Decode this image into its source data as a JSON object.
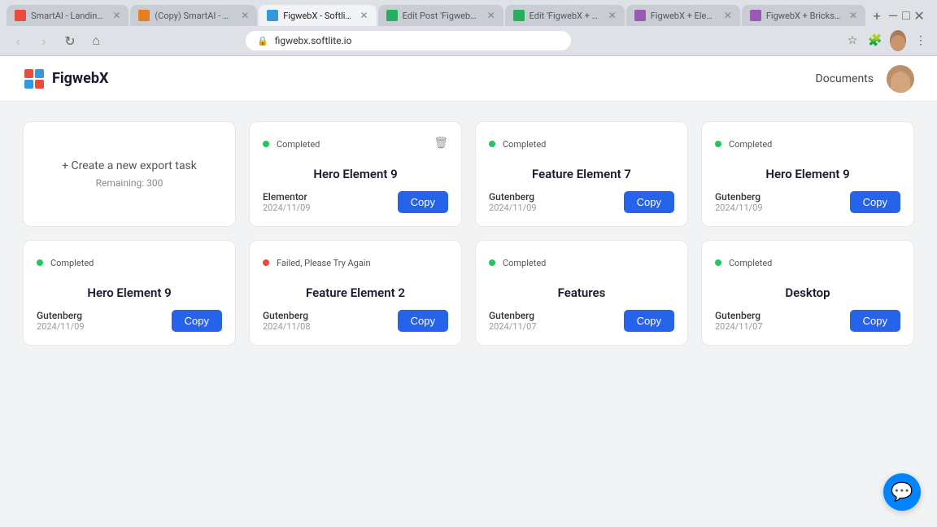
{
  "browser": {
    "tabs": [
      {
        "label": "SmartAI - Landing P...",
        "favicon_color": "#e74c3c",
        "active": false,
        "id": "tab-1"
      },
      {
        "label": "(Copy) SmartAI - Lan...",
        "favicon_color": "#e67e22",
        "active": false,
        "id": "tab-2"
      },
      {
        "label": "FigwebX - Softlite.io",
        "favicon_color": "#3498db",
        "active": true,
        "id": "tab-3"
      },
      {
        "label": "Edit Post 'FigwebX +...",
        "favicon_color": "#27ae60",
        "active": false,
        "id": "tab-4"
      },
      {
        "label": "Edit 'FigwebX + Ele...",
        "favicon_color": "#27ae60",
        "active": false,
        "id": "tab-5"
      },
      {
        "label": "FigwebX + Eleme...",
        "favicon_color": "#9b59b6",
        "active": false,
        "id": "tab-6"
      },
      {
        "label": "FigwebX + Bricks (B...",
        "favicon_color": "#9b59b6",
        "active": false,
        "id": "tab-7"
      }
    ],
    "url": "figwebx.softlite.io",
    "url_lock": "🔒"
  },
  "app": {
    "logo_text": "FigwebX",
    "header_nav": "Documents",
    "create_card": {
      "plus_text": "+ Create a new export task",
      "remaining_text": "Remaining: 300"
    },
    "cards": [
      {
        "status": "completed",
        "status_label": "Completed",
        "title": "Hero Element 9",
        "builder": "Elementor",
        "date": "2024/11/09",
        "copy_label": "Copy",
        "has_delete": true
      },
      {
        "status": "completed",
        "status_label": "Completed",
        "title": "Feature Element 7",
        "builder": "Gutenberg",
        "date": "2024/11/09",
        "copy_label": "Copy",
        "has_delete": false
      },
      {
        "status": "completed",
        "status_label": "Completed",
        "title": "Hero Element 9",
        "builder": "Gutenberg",
        "date": "2024/11/09",
        "copy_label": "Copy",
        "has_delete": false
      },
      {
        "status": "completed",
        "status_label": "Completed",
        "title": "Hero Element 9",
        "builder": "Gutenberg",
        "date": "2024/11/09",
        "copy_label": "Copy",
        "has_delete": false
      },
      {
        "status": "failed",
        "status_label": "Failed, Please Try Again",
        "title": "Feature Element 2",
        "builder": "Gutenberg",
        "date": "2024/11/08",
        "copy_label": "Copy",
        "has_delete": false
      },
      {
        "status": "completed",
        "status_label": "Completed",
        "title": "Features",
        "builder": "Gutenberg",
        "date": "2024/11/07",
        "copy_label": "Copy",
        "has_delete": false
      },
      {
        "status": "completed",
        "status_label": "Completed",
        "title": "Desktop",
        "builder": "Gutenberg",
        "date": "2024/11/07",
        "copy_label": "Copy",
        "has_delete": false
      }
    ]
  }
}
